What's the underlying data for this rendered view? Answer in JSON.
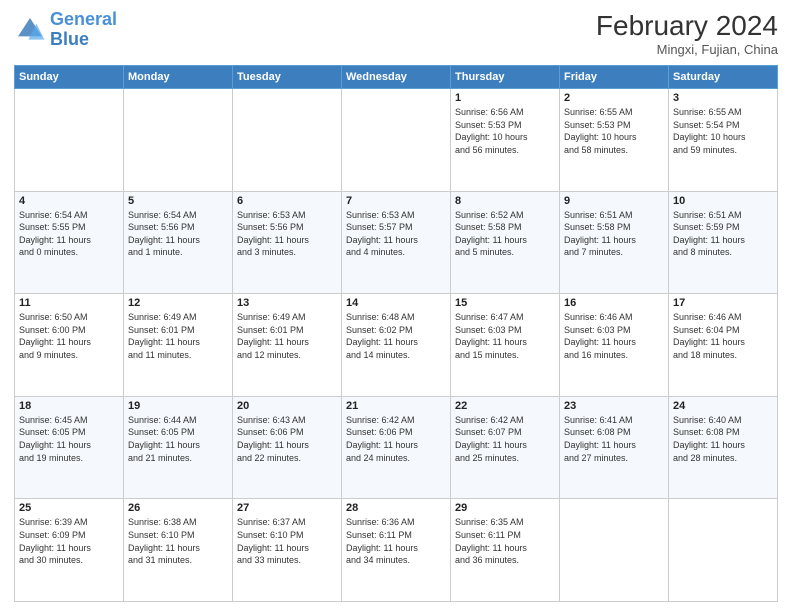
{
  "header": {
    "logo_line1": "General",
    "logo_line2": "Blue",
    "month_title": "February 2024",
    "location": "Mingxi, Fujian, China"
  },
  "days_of_week": [
    "Sunday",
    "Monday",
    "Tuesday",
    "Wednesday",
    "Thursday",
    "Friday",
    "Saturday"
  ],
  "weeks": [
    [
      {
        "day": "",
        "info": ""
      },
      {
        "day": "",
        "info": ""
      },
      {
        "day": "",
        "info": ""
      },
      {
        "day": "",
        "info": ""
      },
      {
        "day": "1",
        "info": "Sunrise: 6:56 AM\nSunset: 5:53 PM\nDaylight: 10 hours\nand 56 minutes."
      },
      {
        "day": "2",
        "info": "Sunrise: 6:55 AM\nSunset: 5:53 PM\nDaylight: 10 hours\nand 58 minutes."
      },
      {
        "day": "3",
        "info": "Sunrise: 6:55 AM\nSunset: 5:54 PM\nDaylight: 10 hours\nand 59 minutes."
      }
    ],
    [
      {
        "day": "4",
        "info": "Sunrise: 6:54 AM\nSunset: 5:55 PM\nDaylight: 11 hours\nand 0 minutes."
      },
      {
        "day": "5",
        "info": "Sunrise: 6:54 AM\nSunset: 5:56 PM\nDaylight: 11 hours\nand 1 minute."
      },
      {
        "day": "6",
        "info": "Sunrise: 6:53 AM\nSunset: 5:56 PM\nDaylight: 11 hours\nand 3 minutes."
      },
      {
        "day": "7",
        "info": "Sunrise: 6:53 AM\nSunset: 5:57 PM\nDaylight: 11 hours\nand 4 minutes."
      },
      {
        "day": "8",
        "info": "Sunrise: 6:52 AM\nSunset: 5:58 PM\nDaylight: 11 hours\nand 5 minutes."
      },
      {
        "day": "9",
        "info": "Sunrise: 6:51 AM\nSunset: 5:58 PM\nDaylight: 11 hours\nand 7 minutes."
      },
      {
        "day": "10",
        "info": "Sunrise: 6:51 AM\nSunset: 5:59 PM\nDaylight: 11 hours\nand 8 minutes."
      }
    ],
    [
      {
        "day": "11",
        "info": "Sunrise: 6:50 AM\nSunset: 6:00 PM\nDaylight: 11 hours\nand 9 minutes."
      },
      {
        "day": "12",
        "info": "Sunrise: 6:49 AM\nSunset: 6:01 PM\nDaylight: 11 hours\nand 11 minutes."
      },
      {
        "day": "13",
        "info": "Sunrise: 6:49 AM\nSunset: 6:01 PM\nDaylight: 11 hours\nand 12 minutes."
      },
      {
        "day": "14",
        "info": "Sunrise: 6:48 AM\nSunset: 6:02 PM\nDaylight: 11 hours\nand 14 minutes."
      },
      {
        "day": "15",
        "info": "Sunrise: 6:47 AM\nSunset: 6:03 PM\nDaylight: 11 hours\nand 15 minutes."
      },
      {
        "day": "16",
        "info": "Sunrise: 6:46 AM\nSunset: 6:03 PM\nDaylight: 11 hours\nand 16 minutes."
      },
      {
        "day": "17",
        "info": "Sunrise: 6:46 AM\nSunset: 6:04 PM\nDaylight: 11 hours\nand 18 minutes."
      }
    ],
    [
      {
        "day": "18",
        "info": "Sunrise: 6:45 AM\nSunset: 6:05 PM\nDaylight: 11 hours\nand 19 minutes."
      },
      {
        "day": "19",
        "info": "Sunrise: 6:44 AM\nSunset: 6:05 PM\nDaylight: 11 hours\nand 21 minutes."
      },
      {
        "day": "20",
        "info": "Sunrise: 6:43 AM\nSunset: 6:06 PM\nDaylight: 11 hours\nand 22 minutes."
      },
      {
        "day": "21",
        "info": "Sunrise: 6:42 AM\nSunset: 6:06 PM\nDaylight: 11 hours\nand 24 minutes."
      },
      {
        "day": "22",
        "info": "Sunrise: 6:42 AM\nSunset: 6:07 PM\nDaylight: 11 hours\nand 25 minutes."
      },
      {
        "day": "23",
        "info": "Sunrise: 6:41 AM\nSunset: 6:08 PM\nDaylight: 11 hours\nand 27 minutes."
      },
      {
        "day": "24",
        "info": "Sunrise: 6:40 AM\nSunset: 6:08 PM\nDaylight: 11 hours\nand 28 minutes."
      }
    ],
    [
      {
        "day": "25",
        "info": "Sunrise: 6:39 AM\nSunset: 6:09 PM\nDaylight: 11 hours\nand 30 minutes."
      },
      {
        "day": "26",
        "info": "Sunrise: 6:38 AM\nSunset: 6:10 PM\nDaylight: 11 hours\nand 31 minutes."
      },
      {
        "day": "27",
        "info": "Sunrise: 6:37 AM\nSunset: 6:10 PM\nDaylight: 11 hours\nand 33 minutes."
      },
      {
        "day": "28",
        "info": "Sunrise: 6:36 AM\nSunset: 6:11 PM\nDaylight: 11 hours\nand 34 minutes."
      },
      {
        "day": "29",
        "info": "Sunrise: 6:35 AM\nSunset: 6:11 PM\nDaylight: 11 hours\nand 36 minutes."
      },
      {
        "day": "",
        "info": ""
      },
      {
        "day": "",
        "info": ""
      }
    ]
  ]
}
